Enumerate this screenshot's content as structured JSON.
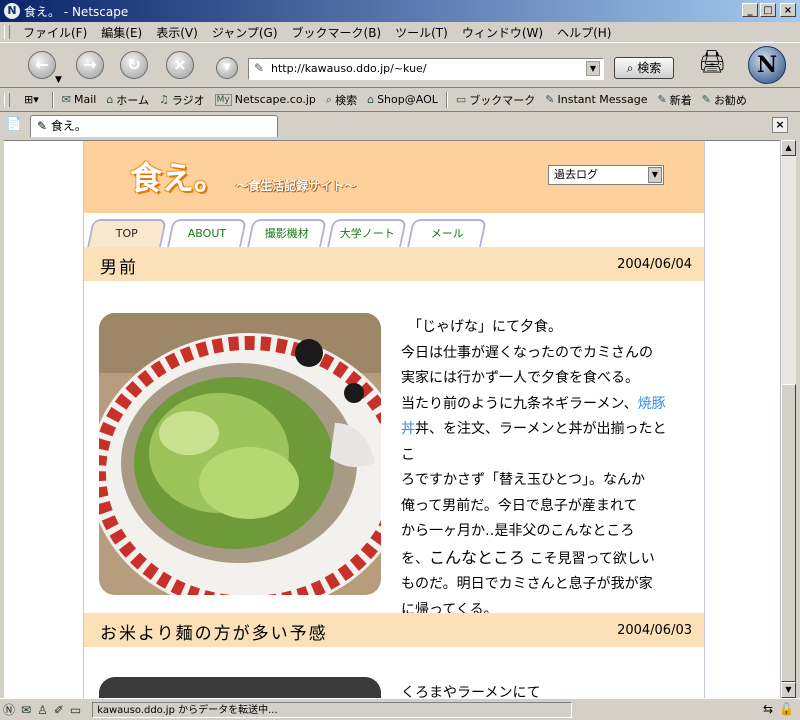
{
  "window": {
    "title": "食え。 - Netscape",
    "controls": {
      "minimize": "_",
      "maximize": "□",
      "close": "×"
    }
  },
  "menu": [
    "ファイル(F)",
    "編集(E)",
    "表示(V)",
    "ジャンプ(G)",
    "ブックマーク(B)",
    "ツール(T)",
    "ウィンドウ(W)",
    "ヘルプ(H)"
  ],
  "nav": {
    "url": "http://kawauso.ddo.jp/~kue/",
    "search_label": "検索",
    "logo_letter": "N"
  },
  "personal_toolbar": [
    {
      "icon": "mail-icon",
      "glyph": "✉",
      "label": "Mail"
    },
    {
      "icon": "home-icon",
      "glyph": "⌂",
      "label": "ホーム"
    },
    {
      "icon": "radio-icon",
      "glyph": "♫",
      "label": "ラジオ"
    },
    {
      "icon": "my-icon",
      "glyph": "My",
      "label": "Netscape.co.jp"
    },
    {
      "icon": "search-icon",
      "glyph": "⌕",
      "label": "検索"
    },
    {
      "icon": "aol-icon",
      "glyph": "⌂",
      "label": "Shop@AOL"
    },
    {
      "icon": "bookmark-icon",
      "glyph": "▭",
      "label": "ブックマーク"
    },
    {
      "icon": "link-icon",
      "glyph": "✎",
      "label": "Instant Message"
    },
    {
      "icon": "link-icon",
      "glyph": "✎",
      "label": "新着"
    },
    {
      "icon": "link-icon",
      "glyph": "✎",
      "label": "お勧め"
    }
  ],
  "tab": {
    "label": "食え。"
  },
  "site": {
    "logo": "食え。",
    "tagline": "～食生活記録サイト～",
    "archive_select": "過去ログ",
    "nav_tabs": [
      "TOP",
      "ABOUT",
      "撮影機材",
      "大学ノート",
      "メール"
    ]
  },
  "posts": [
    {
      "title": "男前",
      "date": "2004/06/04",
      "lines": [
        "　「じゃげな」にて夕食。",
        "今日は仕事が遅くなったのでカミさんの",
        "実家には行かず一人で夕食を食べる。",
        "当たり前のように九条ネギラーメン、",
        "丼、を注文、ラーメンと丼が出揃ったとこ",
        "ろですかさず「替え玉ひとつ」。なんか",
        "俺って男前だ。今日で息子が産まれて",
        "から一ヶ月か‥是非父のこんなところ",
        "を、",
        "ものだ。明日でカミさんと息子が我が家",
        "に帰ってくる。"
      ],
      "link_part1": "焼豚",
      "link_part2": "丼",
      "emphasis": "こんなところ",
      "line9_tail": "こそ見習って欲しい"
    },
    {
      "title": "お米より麺の方が多い予感",
      "date": "2004/06/03",
      "first_line": "くろまやラーメンにて"
    }
  ],
  "status": {
    "text": "kawauso.ddo.jp からデータを転送中..."
  }
}
